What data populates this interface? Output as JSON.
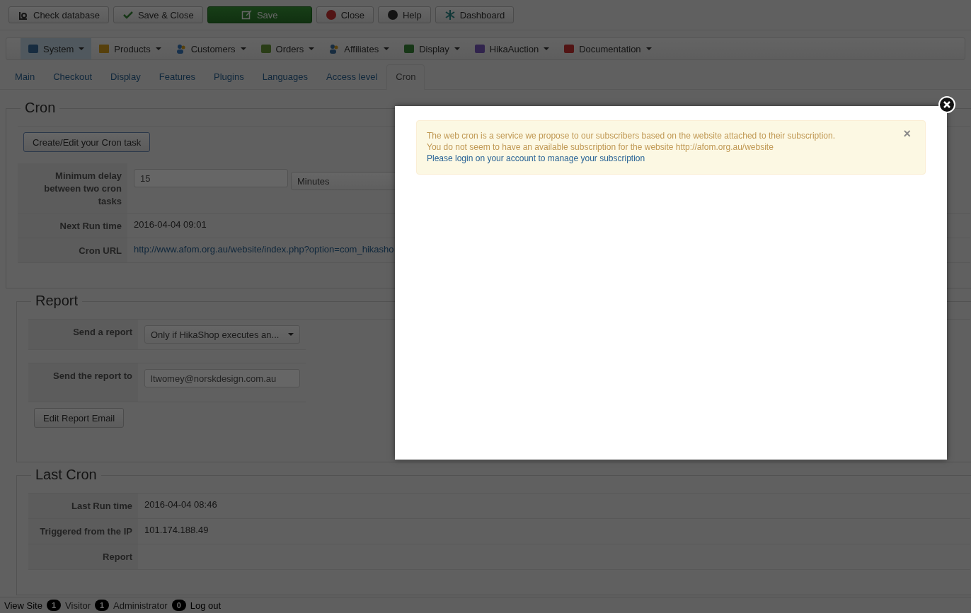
{
  "toolbar": [
    {
      "label": "Check database",
      "kind": "default"
    },
    {
      "label": "Save & Close",
      "kind": "default"
    },
    {
      "label": "Save",
      "kind": "primary"
    },
    {
      "label": "Close",
      "kind": "default"
    },
    {
      "label": "Help",
      "kind": "default"
    },
    {
      "label": "Dashboard",
      "kind": "default"
    }
  ],
  "menu": [
    {
      "label": "System",
      "selected": true
    },
    {
      "label": "Products",
      "selected": false
    },
    {
      "label": "Customers",
      "selected": false
    },
    {
      "label": "Orders",
      "selected": false
    },
    {
      "label": "Affiliates",
      "selected": false
    },
    {
      "label": "Display",
      "selected": false
    },
    {
      "label": "HikaAuction",
      "selected": false
    },
    {
      "label": "Documentation",
      "selected": false
    }
  ],
  "tabs": [
    {
      "label": "Main",
      "selected": false
    },
    {
      "label": "Checkout",
      "selected": false
    },
    {
      "label": "Display",
      "selected": false
    },
    {
      "label": "Features",
      "selected": false
    },
    {
      "label": "Plugins",
      "selected": false
    },
    {
      "label": "Languages",
      "selected": false
    },
    {
      "label": "Access level",
      "selected": false
    },
    {
      "label": "Cron",
      "selected": true
    }
  ],
  "cron": {
    "title": "Cron",
    "button": "Create/Edit your Cron task",
    "delay": {
      "label": "Minimum delay between two cron tasks",
      "value": "15",
      "unit": "Minutes"
    },
    "next_run": {
      "label": "Next Run time",
      "value": "2016-04-04 09:01"
    },
    "url": {
      "label": "Cron URL",
      "value": "http://www.afom.org.au/website/index.php?option=com_hikasho"
    }
  },
  "report": {
    "title": "Report",
    "send": {
      "label": "Send a report",
      "value": "Only if HikaShop executes an..."
    },
    "to": {
      "label": "Send the report to",
      "value": "ltwomey@norskdesign.com.au"
    },
    "button": "Edit Report Email"
  },
  "last_cron": {
    "title": "Last Cron",
    "rows": [
      {
        "label": "Last Run time",
        "value": "2016-04-04 08:46"
      },
      {
        "label": "Triggered from the IP",
        "value": "101.174.188.49"
      },
      {
        "label": "Report",
        "value": null
      }
    ]
  },
  "status_bar": {
    "view_site": "View Site",
    "visitors": {
      "count": "1",
      "label": "Visitor"
    },
    "admins": {
      "count": "1",
      "label": "Administrator"
    },
    "messages": "0",
    "logout": "Log out"
  },
  "modal": {
    "alert": {
      "lines": [
        "The web cron is a service we propose to our subscribers based on the website attached to their subscription.",
        "You do not seem to have an available subscription for the website http://afom.org.au/website"
      ],
      "link": "Please login on your account to manage your subscription",
      "dismiss": "×"
    }
  }
}
